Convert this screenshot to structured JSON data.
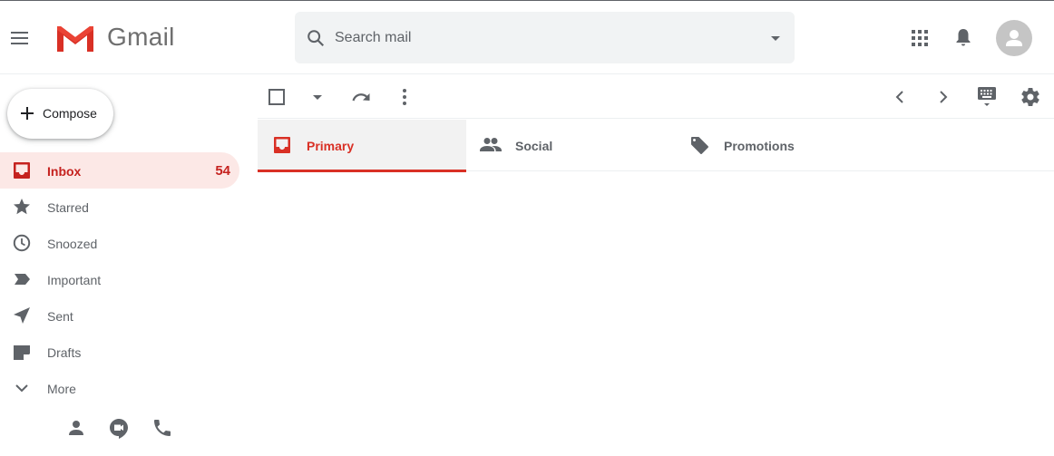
{
  "app": {
    "name": "Gmail"
  },
  "search": {
    "placeholder": "Search mail"
  },
  "compose": {
    "label": "Compose"
  },
  "sidebar": {
    "items": [
      {
        "label": "Inbox",
        "count": "54",
        "icon": "inbox-icon",
        "active": true
      },
      {
        "label": "Starred",
        "icon": "star-icon"
      },
      {
        "label": "Snoozed",
        "icon": "clock-icon"
      },
      {
        "label": "Important",
        "icon": "important-icon"
      },
      {
        "label": "Sent",
        "icon": "send-icon"
      },
      {
        "label": "Drafts",
        "icon": "draft-icon"
      },
      {
        "label": "More",
        "icon": "chevron-down-icon"
      }
    ]
  },
  "tabs": [
    {
      "label": "Primary",
      "icon": "inbox-icon",
      "active": true
    },
    {
      "label": "Social",
      "icon": "people-icon"
    },
    {
      "label": "Promotions",
      "icon": "tag-icon"
    }
  ],
  "colors": {
    "accent": "#d93025",
    "active_bg": "#fce8e6",
    "icon_gray": "#5f6368"
  }
}
